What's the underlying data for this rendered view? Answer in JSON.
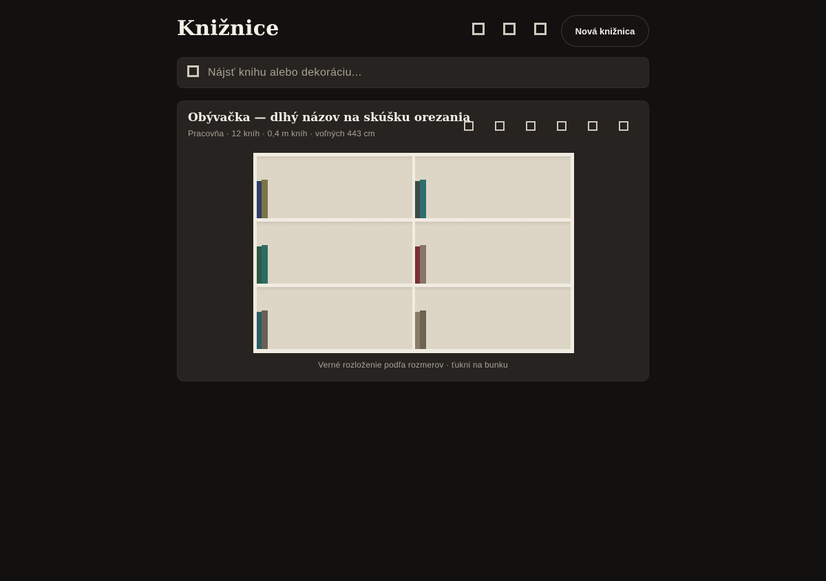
{
  "header": {
    "title": "Knižnice",
    "icons": [
      "square-icon",
      "square-icon",
      "square-icon"
    ],
    "new_button_label": "Nová knižnica"
  },
  "search": {
    "icon": "square-icon",
    "placeholder": "Nájsť knihu alebo dekoráciu..."
  },
  "library": {
    "title": "Obývačka — dlhý názov na skúšku orezania",
    "meta": "Pracovňa · 12 kníh · 0,4 m kníh · voľných 443 cm",
    "icons": [
      "square-icon",
      "square-icon",
      "square-icon",
      "square-icon",
      "square-icon",
      "square-icon"
    ],
    "caption": "Verné rozloženie podľa rozmerov · ťukni na bunku",
    "colors": {
      "frame": "#f1ece2",
      "cell": "#ddd6c6"
    },
    "cells": [
      {
        "books": [
          "#2f3e6a",
          "#7a7445"
        ]
      },
      {
        "books": [
          "#3d4a47",
          "#2c6e6b"
        ]
      },
      {
        "books": [
          "#2e5a44",
          "#2b6d63"
        ]
      },
      {
        "books": [
          "#7a2f35",
          "#86766a"
        ]
      },
      {
        "books": [
          "#2b5e66",
          "#6a6055"
        ]
      },
      {
        "books": [
          "#8a7b6a",
          "#6e6454"
        ]
      }
    ]
  }
}
